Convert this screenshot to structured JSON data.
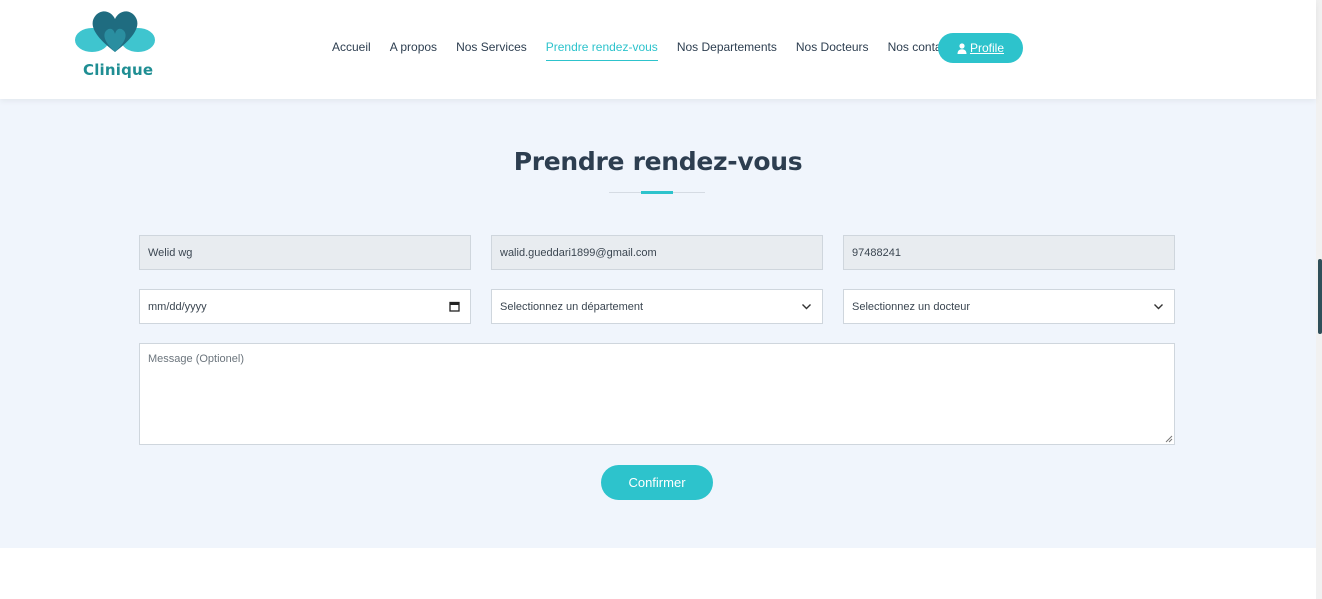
{
  "header": {
    "logo_text": "Clinique",
    "nav": [
      {
        "label": "Accueil",
        "active": false
      },
      {
        "label": "A propos",
        "active": false
      },
      {
        "label": "Nos Services",
        "active": false
      },
      {
        "label": "Prendre rendez-vous",
        "active": true
      },
      {
        "label": "Nos Departements",
        "active": false
      },
      {
        "label": "Nos Docteurs",
        "active": false
      },
      {
        "label": "Nos contacts",
        "active": false
      }
    ],
    "profile_label": "Profile"
  },
  "form": {
    "title": "Prendre rendez-vous",
    "name_value": "Welid wg",
    "email_value": "walid.gueddari1899@gmail.com",
    "phone_value": "97488241",
    "date_placeholder": "mm/dd/yyyy",
    "department_selected": "Selectionnez un département",
    "doctor_selected": "Selectionnez un docteur",
    "message_placeholder": "Message (Optionel)",
    "confirm_label": "Confirmer"
  },
  "colors": {
    "accent": "#2dc3cc",
    "heading": "#2d3e50",
    "section_bg": "#f0f5fc",
    "logo_dark": "#1f5e72"
  },
  "icons": [
    "heart-logo-icon",
    "user-icon",
    "calendar-icon",
    "chevron-down-icon",
    "resize-grip-icon"
  ]
}
